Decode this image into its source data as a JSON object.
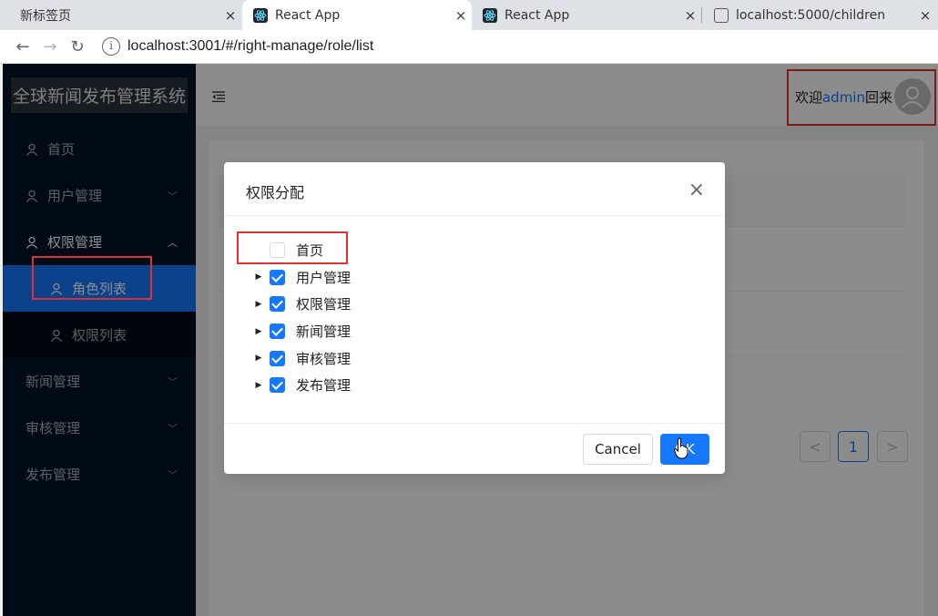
{
  "browser": {
    "tabs": [
      {
        "label": "新标签页",
        "close": "×"
      },
      {
        "label": "React App",
        "close": "×"
      },
      {
        "label": "React App",
        "close": "×"
      },
      {
        "label": "localhost:5000/children",
        "close": "×"
      }
    ],
    "url": "localhost:3001/#/right-manage/role/list"
  },
  "app": {
    "logo": "全球新闻发布管理系统",
    "menu": [
      {
        "label": "首页"
      },
      {
        "label": "用户管理"
      },
      {
        "label": "权限管理"
      },
      {
        "label": "角色列表"
      },
      {
        "label": "权限列表"
      },
      {
        "label": "新闻管理"
      },
      {
        "label": "审核管理"
      },
      {
        "label": "发布管理"
      }
    ],
    "header": {
      "welcome_prefix": "欢迎",
      "username": "admin",
      "welcome_suffix": "回来"
    },
    "pagination": {
      "current": "1",
      "prev": "<",
      "next": ">"
    }
  },
  "modal": {
    "title": "权限分配",
    "close": "×",
    "tree": [
      {
        "label": "首页",
        "checked": false,
        "expandable": false
      },
      {
        "label": "用户管理",
        "checked": true,
        "expandable": true
      },
      {
        "label": "权限管理",
        "checked": true,
        "expandable": true
      },
      {
        "label": "新闻管理",
        "checked": true,
        "expandable": true
      },
      {
        "label": "审核管理",
        "checked": true,
        "expandable": true
      },
      {
        "label": "发布管理",
        "checked": true,
        "expandable": true
      }
    ],
    "cancel_label": "Cancel",
    "ok_label": "OK"
  },
  "colors": {
    "primary": "#1677ff",
    "sidebar_bg": "#001529",
    "highlight_box": "#e03131"
  }
}
